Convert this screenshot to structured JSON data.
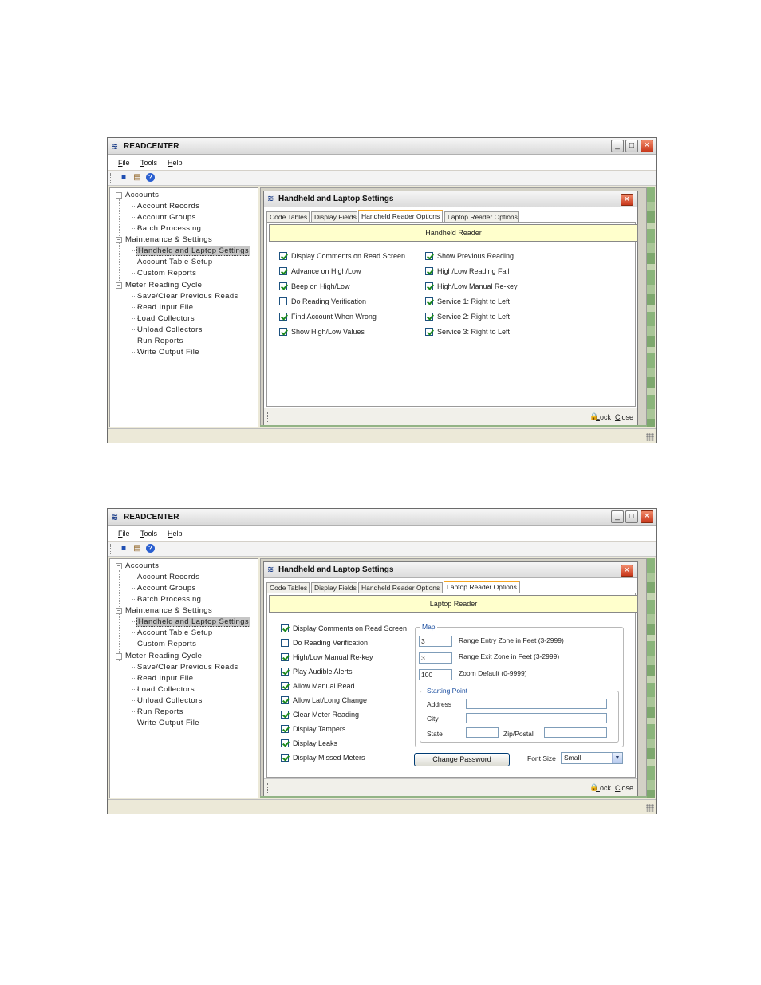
{
  "app": {
    "title": "READCENTER",
    "menu": [
      "File",
      "Tools",
      "Help"
    ],
    "window_buttons": {
      "minimize": "_",
      "maximize": "□",
      "close": "✕"
    }
  },
  "icons": {
    "app_logo": "readcenter-logo-icon",
    "toolbar": [
      "square-icon",
      "properties-icon",
      "help-icon"
    ],
    "lock": "lock-icon"
  },
  "tree": [
    {
      "label": "Accounts",
      "children": [
        "Account Records",
        "Account Groups",
        "Batch Processing"
      ]
    },
    {
      "label": "Maintenance & Settings",
      "children": [
        "Handheld and Laptop Settings",
        "Account Table Setup",
        "Custom Reports"
      ]
    },
    {
      "label": "Meter Reading Cycle",
      "children": [
        "Save/Clear Previous Reads",
        "Read Input File",
        "Load Collectors",
        "Unload Collectors",
        "Run Reports",
        "Write Output File"
      ]
    }
  ],
  "tree_selected": "Handheld and Laptop Settings",
  "dialog": {
    "title": "Handheld and Laptop Settings",
    "tabs": [
      "Code Tables",
      "Display Fields",
      "Handheld Reader Options",
      "Laptop Reader Options"
    ],
    "footer": {
      "lock": "Lock",
      "close": "Close"
    }
  },
  "screen1": {
    "active_tab": "Handheld Reader Options",
    "banner": "Handheld Reader",
    "left_options": [
      {
        "label": "Display Comments on Read Screen",
        "checked": true
      },
      {
        "label": "Advance on High/Low",
        "checked": true
      },
      {
        "label": "Beep on High/Low",
        "checked": true
      },
      {
        "label": "Do Reading Verification",
        "checked": false
      },
      {
        "label": "Find Account When Wrong",
        "checked": true
      },
      {
        "label": "Show High/Low Values",
        "checked": true
      }
    ],
    "right_options": [
      {
        "label": "Show Previous Reading",
        "checked": true
      },
      {
        "label": "High/Low Reading Fail",
        "checked": true
      },
      {
        "label": "High/Low Manual Re-key",
        "checked": true
      },
      {
        "label": "Service 1: Right to Left",
        "checked": true
      },
      {
        "label": "Service 2: Right to Left",
        "checked": true
      },
      {
        "label": "Service 3: Right to Left",
        "checked": true
      }
    ]
  },
  "screen2": {
    "active_tab": "Laptop Reader Options",
    "banner": "Laptop Reader",
    "options": [
      {
        "label": "Display Comments on Read Screen",
        "checked": true
      },
      {
        "label": "Do Reading Verification",
        "checked": false
      },
      {
        "label": "High/Low Manual Re-key",
        "checked": true
      },
      {
        "label": "Play Audible Alerts",
        "checked": true
      },
      {
        "label": "Allow Manual Read",
        "checked": true
      },
      {
        "label": "Allow Lat/Long Change",
        "checked": true
      },
      {
        "label": "Clear Meter Reading",
        "checked": true
      },
      {
        "label": "Display Tampers",
        "checked": true
      },
      {
        "label": "Display Leaks",
        "checked": true
      },
      {
        "label": "Display Missed Meters",
        "checked": true
      }
    ],
    "map": {
      "label": "Map",
      "range_entry": {
        "value": "3",
        "label": "Range Entry Zone in Feet (3-2999)"
      },
      "range_exit": {
        "value": "3",
        "label": "Range Exit Zone in Feet (3-2999)"
      },
      "zoom": {
        "value": "100",
        "label": "Zoom Default (0-9999)"
      },
      "starting_point": {
        "label": "Starting Point",
        "address_label": "Address",
        "city_label": "City",
        "state_label": "State",
        "zip_label": "Zip/Postal"
      }
    },
    "change_password": "Change Password",
    "font_size_label": "Font Size",
    "font_size_value": "Small"
  }
}
